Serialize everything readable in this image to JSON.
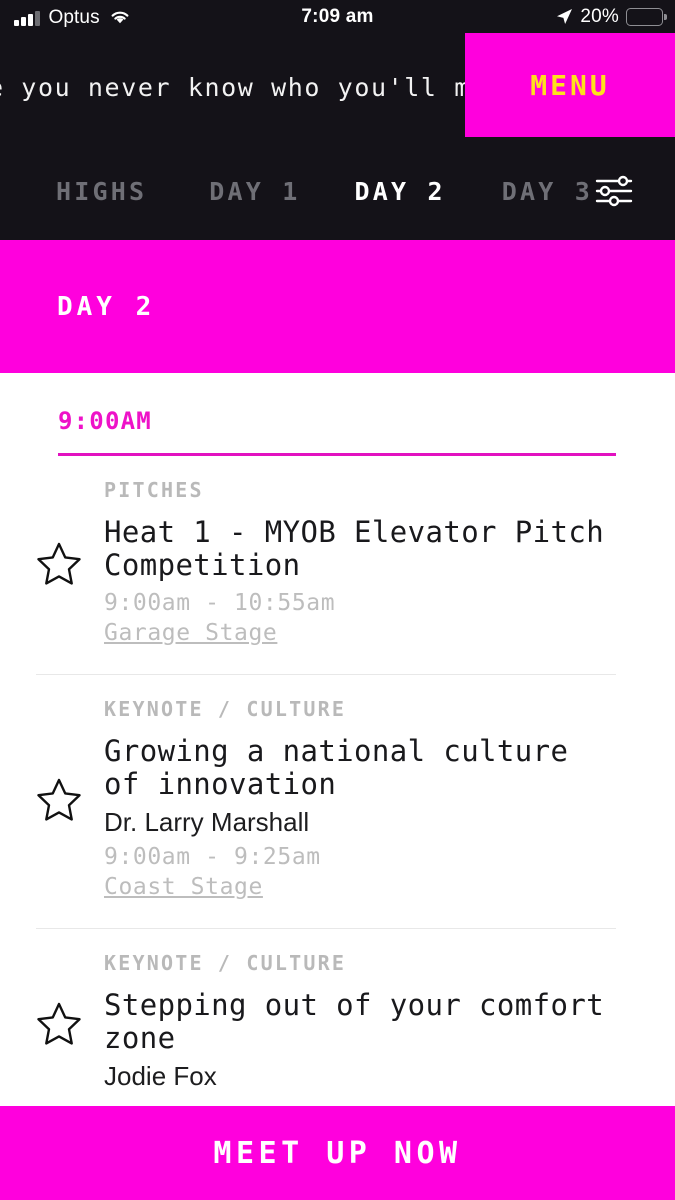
{
  "status_bar": {
    "carrier": "Optus",
    "time": "7:09 am",
    "battery_percent": "20%",
    "signal_icon": "signal-bars-icon",
    "wifi_icon": "wifi-icon",
    "location_icon": "location-arrow-icon",
    "battery_icon": "battery-icon",
    "battery_level": 20,
    "battery_color": "#ff3b30"
  },
  "ticker": {
    "text": "e you never know who you'll matc"
  },
  "menu_button": {
    "label": "MENU",
    "background": "#ff00dd",
    "text_color": "#ffe11b"
  },
  "tabs": {
    "items": [
      {
        "label": "HIGHS",
        "active": false
      },
      {
        "label": "DAY 1",
        "active": false
      },
      {
        "label": "DAY 2",
        "active": true
      },
      {
        "label": "DAY 3",
        "active": false
      }
    ],
    "filter_icon": "filter-sliders-icon"
  },
  "day_banner": {
    "title": "DAY 2",
    "background": "#ff00dd"
  },
  "schedule": {
    "time_slot": "9:00AM",
    "accent_color": "#ee12c8",
    "events": [
      {
        "tag": "PITCHES",
        "tag_parts": [
          "PITCHES"
        ],
        "title": "Heat 1 - MYOB Elevator Pitch Competition",
        "speaker": "",
        "time": "9:00am - 10:55am",
        "venue": "Garage Stage",
        "star_icon": "star-outline-icon"
      },
      {
        "tag": "KEYNOTE / CULTURE",
        "tag_parts": [
          "KEYNOTE",
          "CULTURE"
        ],
        "title": "Growing a national culture of innovation",
        "speaker": "Dr. Larry Marshall",
        "time": "9:00am - 9:25am",
        "venue": "Coast Stage",
        "star_icon": "star-outline-icon"
      },
      {
        "tag": "KEYNOTE / CULTURE",
        "tag_parts": [
          "KEYNOTE",
          "CULTURE"
        ],
        "title": "Stepping out of your comfort zone",
        "speaker": "Jodie Fox",
        "time": "",
        "venue": "",
        "star_icon": "star-outline-icon"
      }
    ]
  },
  "cta": {
    "label": "MEET UP NOW",
    "background": "#ff00dd"
  }
}
